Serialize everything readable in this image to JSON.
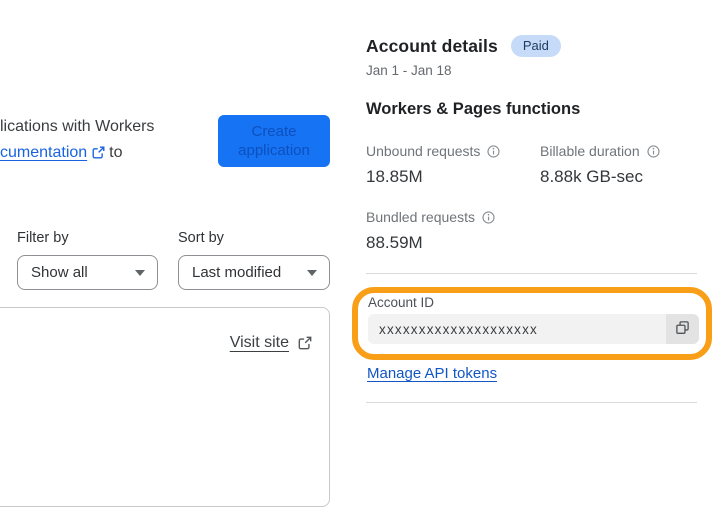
{
  "colors": {
    "annotation_orange": "#f89e17",
    "primary_button_blue": "#1673f4",
    "link_blue": "#1156c5",
    "badge_bg": "#c6dbf8",
    "badge_text": "#1e3c61"
  },
  "icons": {
    "external_link": "box-with-arrow",
    "info": "circled-i",
    "caret_down": "triangle-down",
    "copy": "overlapping-squares"
  },
  "left": {
    "intro": {
      "line1": "lications with Workers",
      "link_text": "cumentation",
      "after_link": "to"
    },
    "create_button_label": "Create application",
    "filter": {
      "label": "Filter by",
      "value": "Show all"
    },
    "sort": {
      "label": "Sort by",
      "value": "Last modified"
    },
    "card": {
      "visit_site_label": "Visit site"
    }
  },
  "right": {
    "title": "Account details",
    "badge": "Paid",
    "date_range": "Jan 1 - Jan 18",
    "section_title": "Workers & Pages functions",
    "stats": [
      {
        "label": "Unbound requests",
        "value": "18.85M"
      },
      {
        "label": "Billable duration",
        "value": "8.88k GB-sec"
      },
      {
        "label": "Bundled requests",
        "value": "88.59M"
      }
    ],
    "account_id": {
      "label": "Account ID",
      "value": "xxxxxxxxxxxxxxxxxxxx"
    },
    "manage_link": "Manage API tokens"
  }
}
